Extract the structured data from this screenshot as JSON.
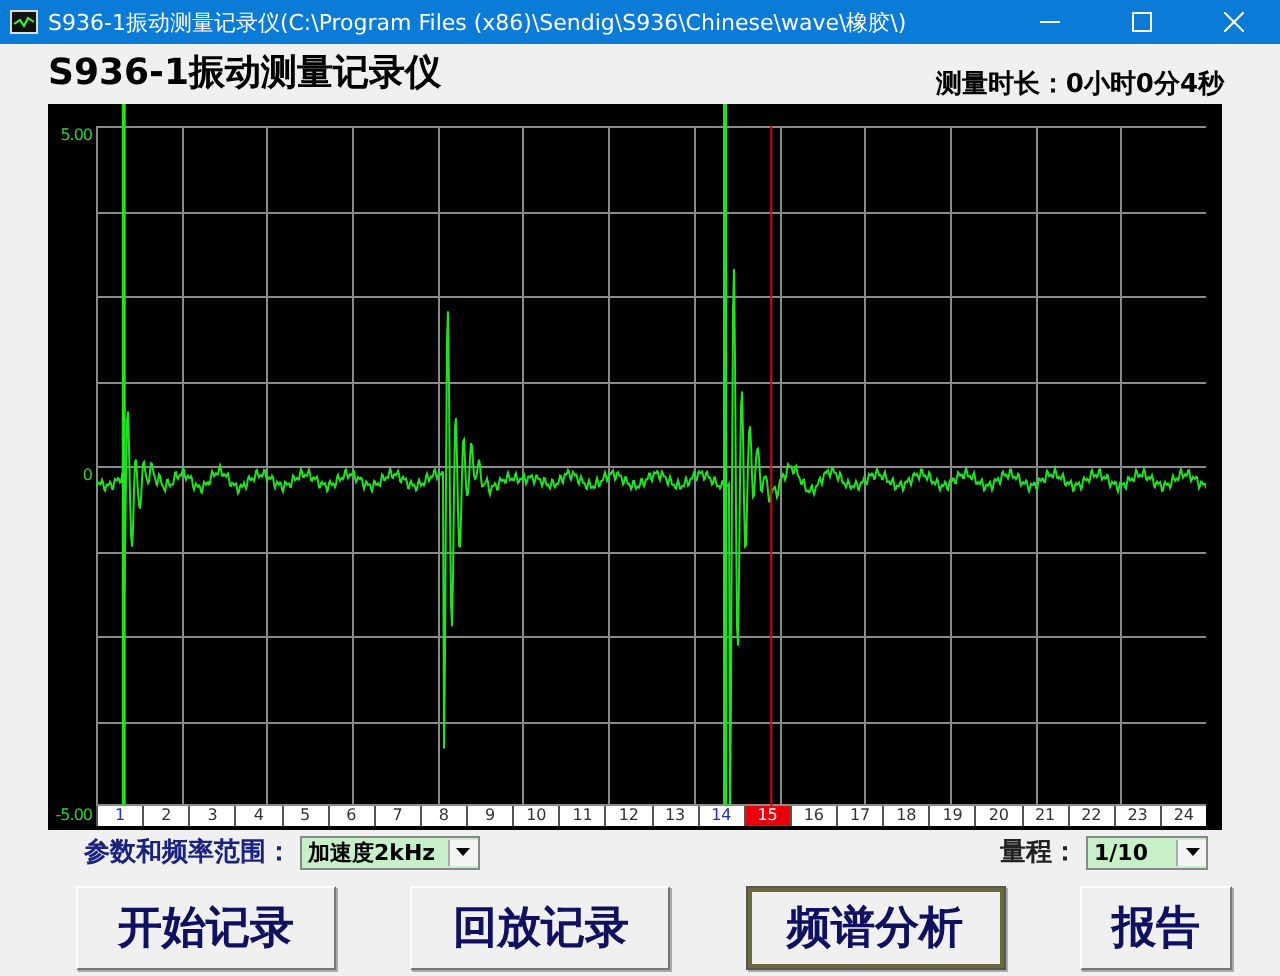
{
  "window": {
    "title": "S936-1振动测量记录仪(C:\\Program Files (x86)\\Sendig\\S936\\Chinese\\wave\\橡胶\\)"
  },
  "header": {
    "title": "S936-1振动测量记录仪",
    "duration": "测量时长：0小时0分4秒"
  },
  "plot": {
    "y_labels": [
      "5.00",
      "0",
      "-5.00"
    ],
    "cells": [
      {
        "label": "1",
        "selected": false,
        "marker": true
      },
      {
        "label": "2",
        "selected": false,
        "marker": false
      },
      {
        "label": "3",
        "selected": false,
        "marker": false
      },
      {
        "label": "4",
        "selected": false,
        "marker": false
      },
      {
        "label": "5",
        "selected": false,
        "marker": false
      },
      {
        "label": "6",
        "selected": false,
        "marker": false
      },
      {
        "label": "7",
        "selected": false,
        "marker": false
      },
      {
        "label": "8",
        "selected": false,
        "marker": false
      },
      {
        "label": "9",
        "selected": false,
        "marker": false
      },
      {
        "label": "10",
        "selected": false,
        "marker": false
      },
      {
        "label": "11",
        "selected": false,
        "marker": false
      },
      {
        "label": "12",
        "selected": false,
        "marker": false
      },
      {
        "label": "13",
        "selected": false,
        "marker": false
      },
      {
        "label": "14",
        "selected": false,
        "marker": true
      },
      {
        "label": "15",
        "selected": true,
        "marker": false
      },
      {
        "label": "16",
        "selected": false,
        "marker": false
      },
      {
        "label": "17",
        "selected": false,
        "marker": false
      },
      {
        "label": "18",
        "selected": false,
        "marker": false
      },
      {
        "label": "19",
        "selected": false,
        "marker": false
      },
      {
        "label": "20",
        "selected": false,
        "marker": false
      },
      {
        "label": "21",
        "selected": false,
        "marker": false
      },
      {
        "label": "22",
        "selected": false,
        "marker": false
      },
      {
        "label": "23",
        "selected": false,
        "marker": false
      },
      {
        "label": "24",
        "selected": false,
        "marker": false
      }
    ]
  },
  "controls": {
    "range_label": "参数和频率范围：",
    "range_value": "加速度2kHz",
    "scale_label": "量程：",
    "scale_value": "1/10"
  },
  "buttons": [
    {
      "label": "开始记录",
      "focused": false
    },
    {
      "label": "回放记录",
      "focused": false
    },
    {
      "label": "频谱分析",
      "focused": true
    },
    {
      "label": "报告",
      "focused": false
    }
  ]
}
